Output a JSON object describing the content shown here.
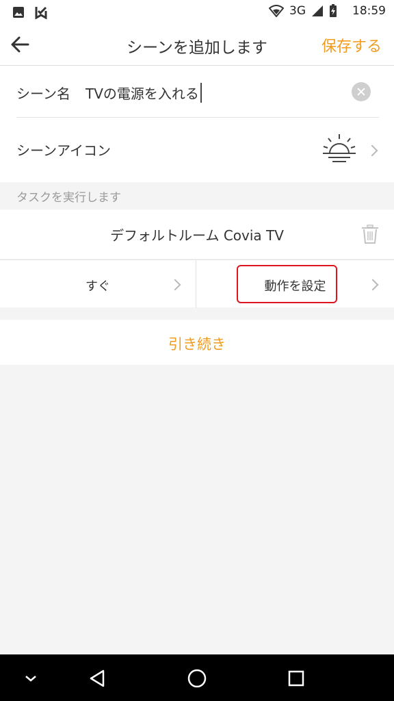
{
  "status_bar": {
    "network": "3G",
    "time": "18:59"
  },
  "app_bar": {
    "title": "シーンを追加します",
    "save_label": "保存する"
  },
  "scene": {
    "name_label": "シーン名",
    "name_value": "TVの電源を入れる",
    "icon_label": "シーンアイコン"
  },
  "tasks": {
    "header": "タスクを実行します",
    "device_title": "デフォルトルーム Covia TV",
    "timing_label": "すぐ",
    "action_label": "動作を設定"
  },
  "continue_label": "引き続き",
  "colors": {
    "accent": "#f29b1c",
    "highlight_box": "#e0141e"
  },
  "icons": {
    "back": "arrow-left-icon",
    "clear": "clear-circle-icon",
    "scene": "sunrise-icon",
    "trash": "trash-icon",
    "chevron": "chevron-right-icon",
    "nav_back": "triangle-back-icon",
    "nav_home": "circle-home-icon",
    "nav_recent": "square-recent-icon",
    "nav_down": "chevron-down-icon"
  }
}
